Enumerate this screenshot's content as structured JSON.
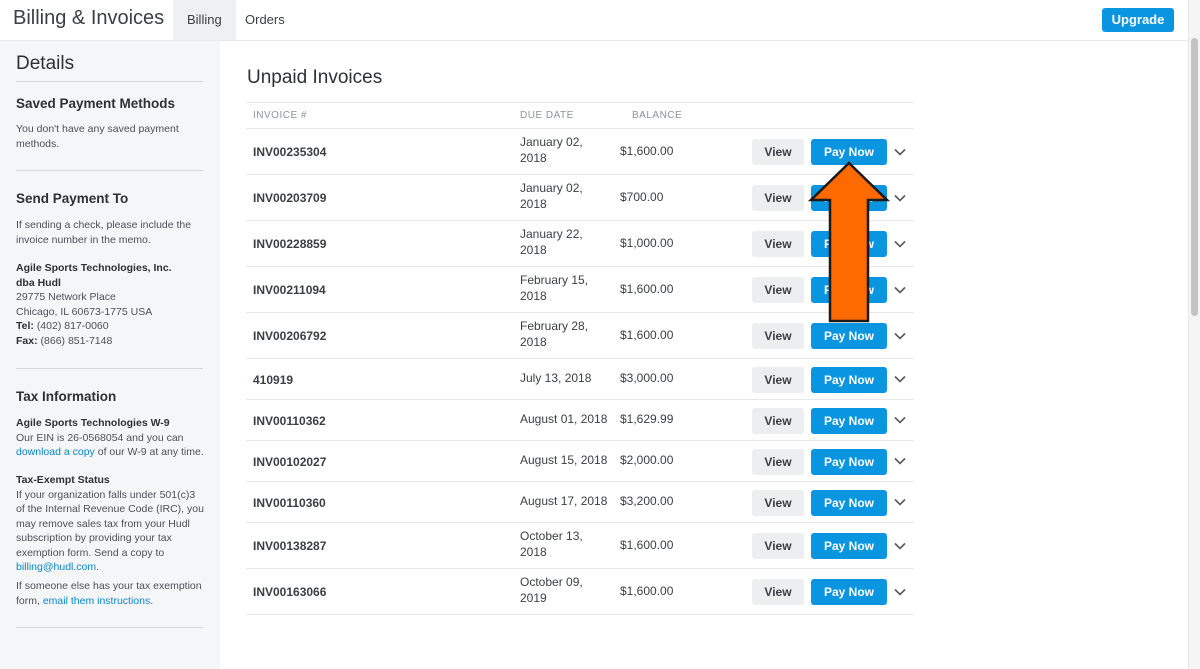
{
  "header": {
    "title": "Billing & Invoices",
    "tabs": [
      "Billing",
      "Orders"
    ],
    "upgrade_label": "Upgrade"
  },
  "sidebar": {
    "title": "Details",
    "saved_payment": {
      "heading": "Saved Payment Methods",
      "text": "You don't have any saved payment methods."
    },
    "send_payment": {
      "heading": "Send Payment To",
      "text": "If sending a check, please include the invoice number in the memo.",
      "company": "Agile Sports Technologies, Inc.",
      "dba": "dba Hudl",
      "address1": "29775 Network Place",
      "address2": "Chicago, IL 60673-1775 USA",
      "tel_label": "Tel:",
      "tel": "(402) 817-0060",
      "fax_label": "Fax:",
      "fax": "(866) 851-7148"
    },
    "tax": {
      "heading": "Tax Information",
      "w9_title": "Agile Sports Technologies W-9",
      "w9_text_1": "Our EIN is 26-0568054 and you can",
      "w9_link": "download a copy",
      "w9_text_2": "of our W-9 at any time.",
      "exempt_title": "Tax-Exempt Status",
      "exempt_text_1": "If your organization falls under 501(c)3 of the Internal Revenue Code (IRC), you may remove sales tax from your Hudl subscription by providing your tax exemption form. Send a copy to",
      "exempt_email": "billing@hudl.com",
      "exempt_text_end": ".",
      "else_text": "If someone else has your tax exemption form,",
      "else_link": "email them instructions",
      "else_end": "."
    }
  },
  "main": {
    "title": "Unpaid Invoices",
    "columns": [
      "INVOICE #",
      "DUE DATE",
      "BALANCE"
    ],
    "view_label": "View",
    "pay_label": "Pay Now",
    "invoices": [
      {
        "invoice": "INV00235304",
        "due_line1": "January 02,",
        "due_line2": "2018",
        "balance": "$1,600.00"
      },
      {
        "invoice": "INV00203709",
        "due_line1": "January 02,",
        "due_line2": "2018",
        "balance": "$700.00"
      },
      {
        "invoice": "INV00228859",
        "due_line1": "January 22,",
        "due_line2": "2018",
        "balance": "$1,000.00"
      },
      {
        "invoice": "INV00211094",
        "due_line1": "February 15,",
        "due_line2": "2018",
        "balance": "$1,600.00"
      },
      {
        "invoice": "INV00206792",
        "due_line1": "February 28,",
        "due_line2": "2018",
        "balance": "$1,600.00"
      },
      {
        "invoice": "410919",
        "due_line1": "July 13, 2018",
        "due_line2": "",
        "balance": "$3,000.00"
      },
      {
        "invoice": "INV00110362",
        "due_line1": "August 01, 2018",
        "due_line2": "",
        "balance": "$1,629.99"
      },
      {
        "invoice": "INV00102027",
        "due_line1": "August 15, 2018",
        "due_line2": "",
        "balance": "$2,000.00"
      },
      {
        "invoice": "INV00110360",
        "due_line1": "August 17, 2018",
        "due_line2": "",
        "balance": "$3,200.00"
      },
      {
        "invoice": "INV00138287",
        "due_line1": "October 13,",
        "due_line2": "2018",
        "balance": "$1,600.00"
      },
      {
        "invoice": "INV00163066",
        "due_line1": "October 09,",
        "due_line2": "2019",
        "balance": "$1,600.00"
      }
    ]
  },
  "colors": {
    "accent": "#0a95e0",
    "arrow": "#ff6a00",
    "sidebar_bg": "#f5f6f7"
  },
  "icons": [
    "chevron-down-icon",
    "up-arrow-annotation"
  ]
}
